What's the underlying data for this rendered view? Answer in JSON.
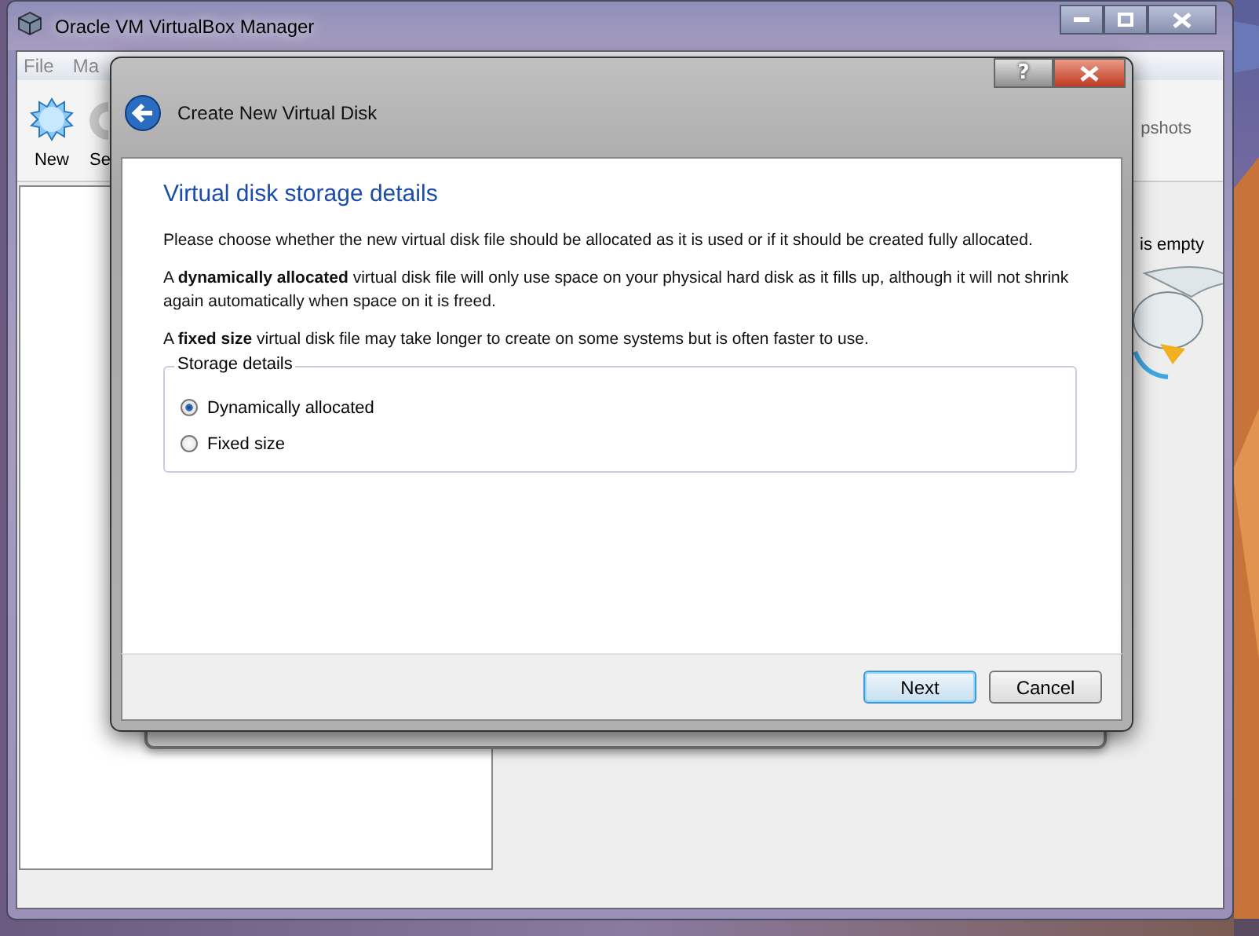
{
  "main_window": {
    "title": "Oracle VM VirtualBox Manager",
    "menu": [
      "File",
      "Ma"
    ],
    "toolbar": [
      {
        "label": "New",
        "kind": "new"
      },
      {
        "label": "Se",
        "kind": "settings"
      }
    ],
    "tab_fragment": "pshots",
    "panel_text": "is empty"
  },
  "dialog": {
    "help": "?",
    "title": "Create New Virtual Disk",
    "heading": "Virtual disk storage details",
    "paragraphs": [
      "Please choose whether the new virtual disk file should be allocated as it is used or if it should be created fully allocated.",
      "A **dynamically allocated** virtual disk file will only use space on your physical hard disk as it fills up, although it will not shrink again automatically when space on it is freed.",
      "A **fixed size** virtual disk file may take longer to create on some systems but is often faster to use."
    ],
    "group": {
      "title": "Storage details",
      "options": [
        {
          "label": "Dynamically allocated",
          "selected": true
        },
        {
          "label": "Fixed size",
          "selected": false
        }
      ]
    },
    "buttons": [
      {
        "label": "Next",
        "default": true
      },
      {
        "label": "Cancel",
        "default": false
      }
    ]
  }
}
